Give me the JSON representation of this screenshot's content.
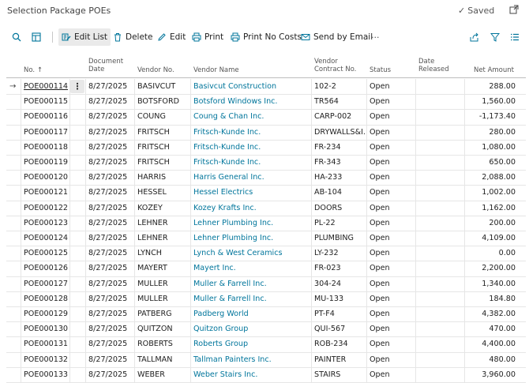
{
  "header": {
    "title": "Selection Package POEs",
    "saved_label": "Saved"
  },
  "toolbar": {
    "edit_list": "Edit List",
    "delete": "Delete",
    "edit": "Edit",
    "print": "Print",
    "print_no_costs": "Print No Costs",
    "send_by_email": "Send by Email",
    "more": "···"
  },
  "columns": {
    "no": "No. ↑",
    "document_date_1": "Document",
    "document_date_2": "Date",
    "vendor_no": "Vendor No.",
    "vendor_name": "Vendor Name",
    "vendor_contract_1": "Vendor",
    "vendor_contract_2": "Contract No.",
    "status": "Status",
    "date_released_1": "Date",
    "date_released_2": "Released",
    "net_amount": "Net Amount"
  },
  "rows": [
    {
      "no": "POE000114",
      "date": "8/27/2025",
      "vendor_no": "BASIVCUT",
      "vendor_name": "Basivcut Construction",
      "contract": "102-2",
      "status": "Open",
      "released": "",
      "amount": "288.00"
    },
    {
      "no": "POE000115",
      "date": "8/27/2025",
      "vendor_no": "BOTSFORD",
      "vendor_name": "Botsford Windows Inc.",
      "contract": "TR564",
      "status": "Open",
      "released": "",
      "amount": "1,560.00"
    },
    {
      "no": "POE000116",
      "date": "8/27/2025",
      "vendor_no": "COUNG",
      "vendor_name": "Coung & Chan Inc.",
      "contract": "CARP-002",
      "status": "Open",
      "released": "",
      "amount": "-1,173.40"
    },
    {
      "no": "POE000117",
      "date": "8/27/2025",
      "vendor_no": "FRITSCH",
      "vendor_name": "Fritsch-Kunde Inc.",
      "contract": "DRYWALLS&I...",
      "status": "Open",
      "released": "",
      "amount": "280.00"
    },
    {
      "no": "POE000118",
      "date": "8/27/2025",
      "vendor_no": "FRITSCH",
      "vendor_name": "Fritsch-Kunde Inc.",
      "contract": "FR-234",
      "status": "Open",
      "released": "",
      "amount": "1,080.00"
    },
    {
      "no": "POE000119",
      "date": "8/27/2025",
      "vendor_no": "FRITSCH",
      "vendor_name": "Fritsch-Kunde Inc.",
      "contract": "FR-343",
      "status": "Open",
      "released": "",
      "amount": "650.00"
    },
    {
      "no": "POE000120",
      "date": "8/27/2025",
      "vendor_no": "HARRIS",
      "vendor_name": "Harris General Inc.",
      "contract": "HA-233",
      "status": "Open",
      "released": "",
      "amount": "2,088.00"
    },
    {
      "no": "POE000121",
      "date": "8/27/2025",
      "vendor_no": "HESSEL",
      "vendor_name": "Hessel Electrics",
      "contract": "AB-104",
      "status": "Open",
      "released": "",
      "amount": "1,002.00"
    },
    {
      "no": "POE000122",
      "date": "8/27/2025",
      "vendor_no": "KOZEY",
      "vendor_name": "Kozey Krafts Inc.",
      "contract": "DOORS",
      "status": "Open",
      "released": "",
      "amount": "1,162.00"
    },
    {
      "no": "POE000123",
      "date": "8/27/2025",
      "vendor_no": "LEHNER",
      "vendor_name": "Lehner Plumbing Inc.",
      "contract": "PL-22",
      "status": "Open",
      "released": "",
      "amount": "200.00"
    },
    {
      "no": "POE000124",
      "date": "8/27/2025",
      "vendor_no": "LEHNER",
      "vendor_name": "Lehner Plumbing Inc.",
      "contract": "PLUMBING",
      "status": "Open",
      "released": "",
      "amount": "4,109.00"
    },
    {
      "no": "POE000125",
      "date": "8/27/2025",
      "vendor_no": "LYNCH",
      "vendor_name": "Lynch & West Ceramics",
      "contract": "LY-232",
      "status": "Open",
      "released": "",
      "amount": "0.00"
    },
    {
      "no": "POE000126",
      "date": "8/27/2025",
      "vendor_no": "MAYERT",
      "vendor_name": "Mayert Inc.",
      "contract": "FR-023",
      "status": "Open",
      "released": "",
      "amount": "2,200.00"
    },
    {
      "no": "POE000127",
      "date": "8/27/2025",
      "vendor_no": "MULLER",
      "vendor_name": "Muller & Farrell Inc.",
      "contract": "304-24",
      "status": "Open",
      "released": "",
      "amount": "1,340.00"
    },
    {
      "no": "POE000128",
      "date": "8/27/2025",
      "vendor_no": "MULLER",
      "vendor_name": "Muller & Farrell Inc.",
      "contract": "MU-133",
      "status": "Open",
      "released": "",
      "amount": "184.80"
    },
    {
      "no": "POE000129",
      "date": "8/27/2025",
      "vendor_no": "PATBERG",
      "vendor_name": "Padberg World",
      "contract": "PT-F4",
      "status": "Open",
      "released": "",
      "amount": "4,382.00"
    },
    {
      "no": "POE000130",
      "date": "8/27/2025",
      "vendor_no": "QUITZON",
      "vendor_name": "Quitzon Group",
      "contract": "QUI-567",
      "status": "Open",
      "released": "",
      "amount": "470.00"
    },
    {
      "no": "POE000131",
      "date": "8/27/2025",
      "vendor_no": "ROBERTS",
      "vendor_name": "Roberts Group",
      "contract": "ROB-234",
      "status": "Open",
      "released": "",
      "amount": "4,400.00"
    },
    {
      "no": "POE000132",
      "date": "8/27/2025",
      "vendor_no": "TALLMAN",
      "vendor_name": "Tallman Painters Inc.",
      "contract": "PAINTER",
      "status": "Open",
      "released": "",
      "amount": "480.00"
    },
    {
      "no": "POE000133",
      "date": "8/27/2025",
      "vendor_no": "WEBER",
      "vendor_name": "Weber Stairs Inc.",
      "contract": "STAIRS",
      "status": "Open",
      "released": "",
      "amount": "3,960.00"
    }
  ]
}
